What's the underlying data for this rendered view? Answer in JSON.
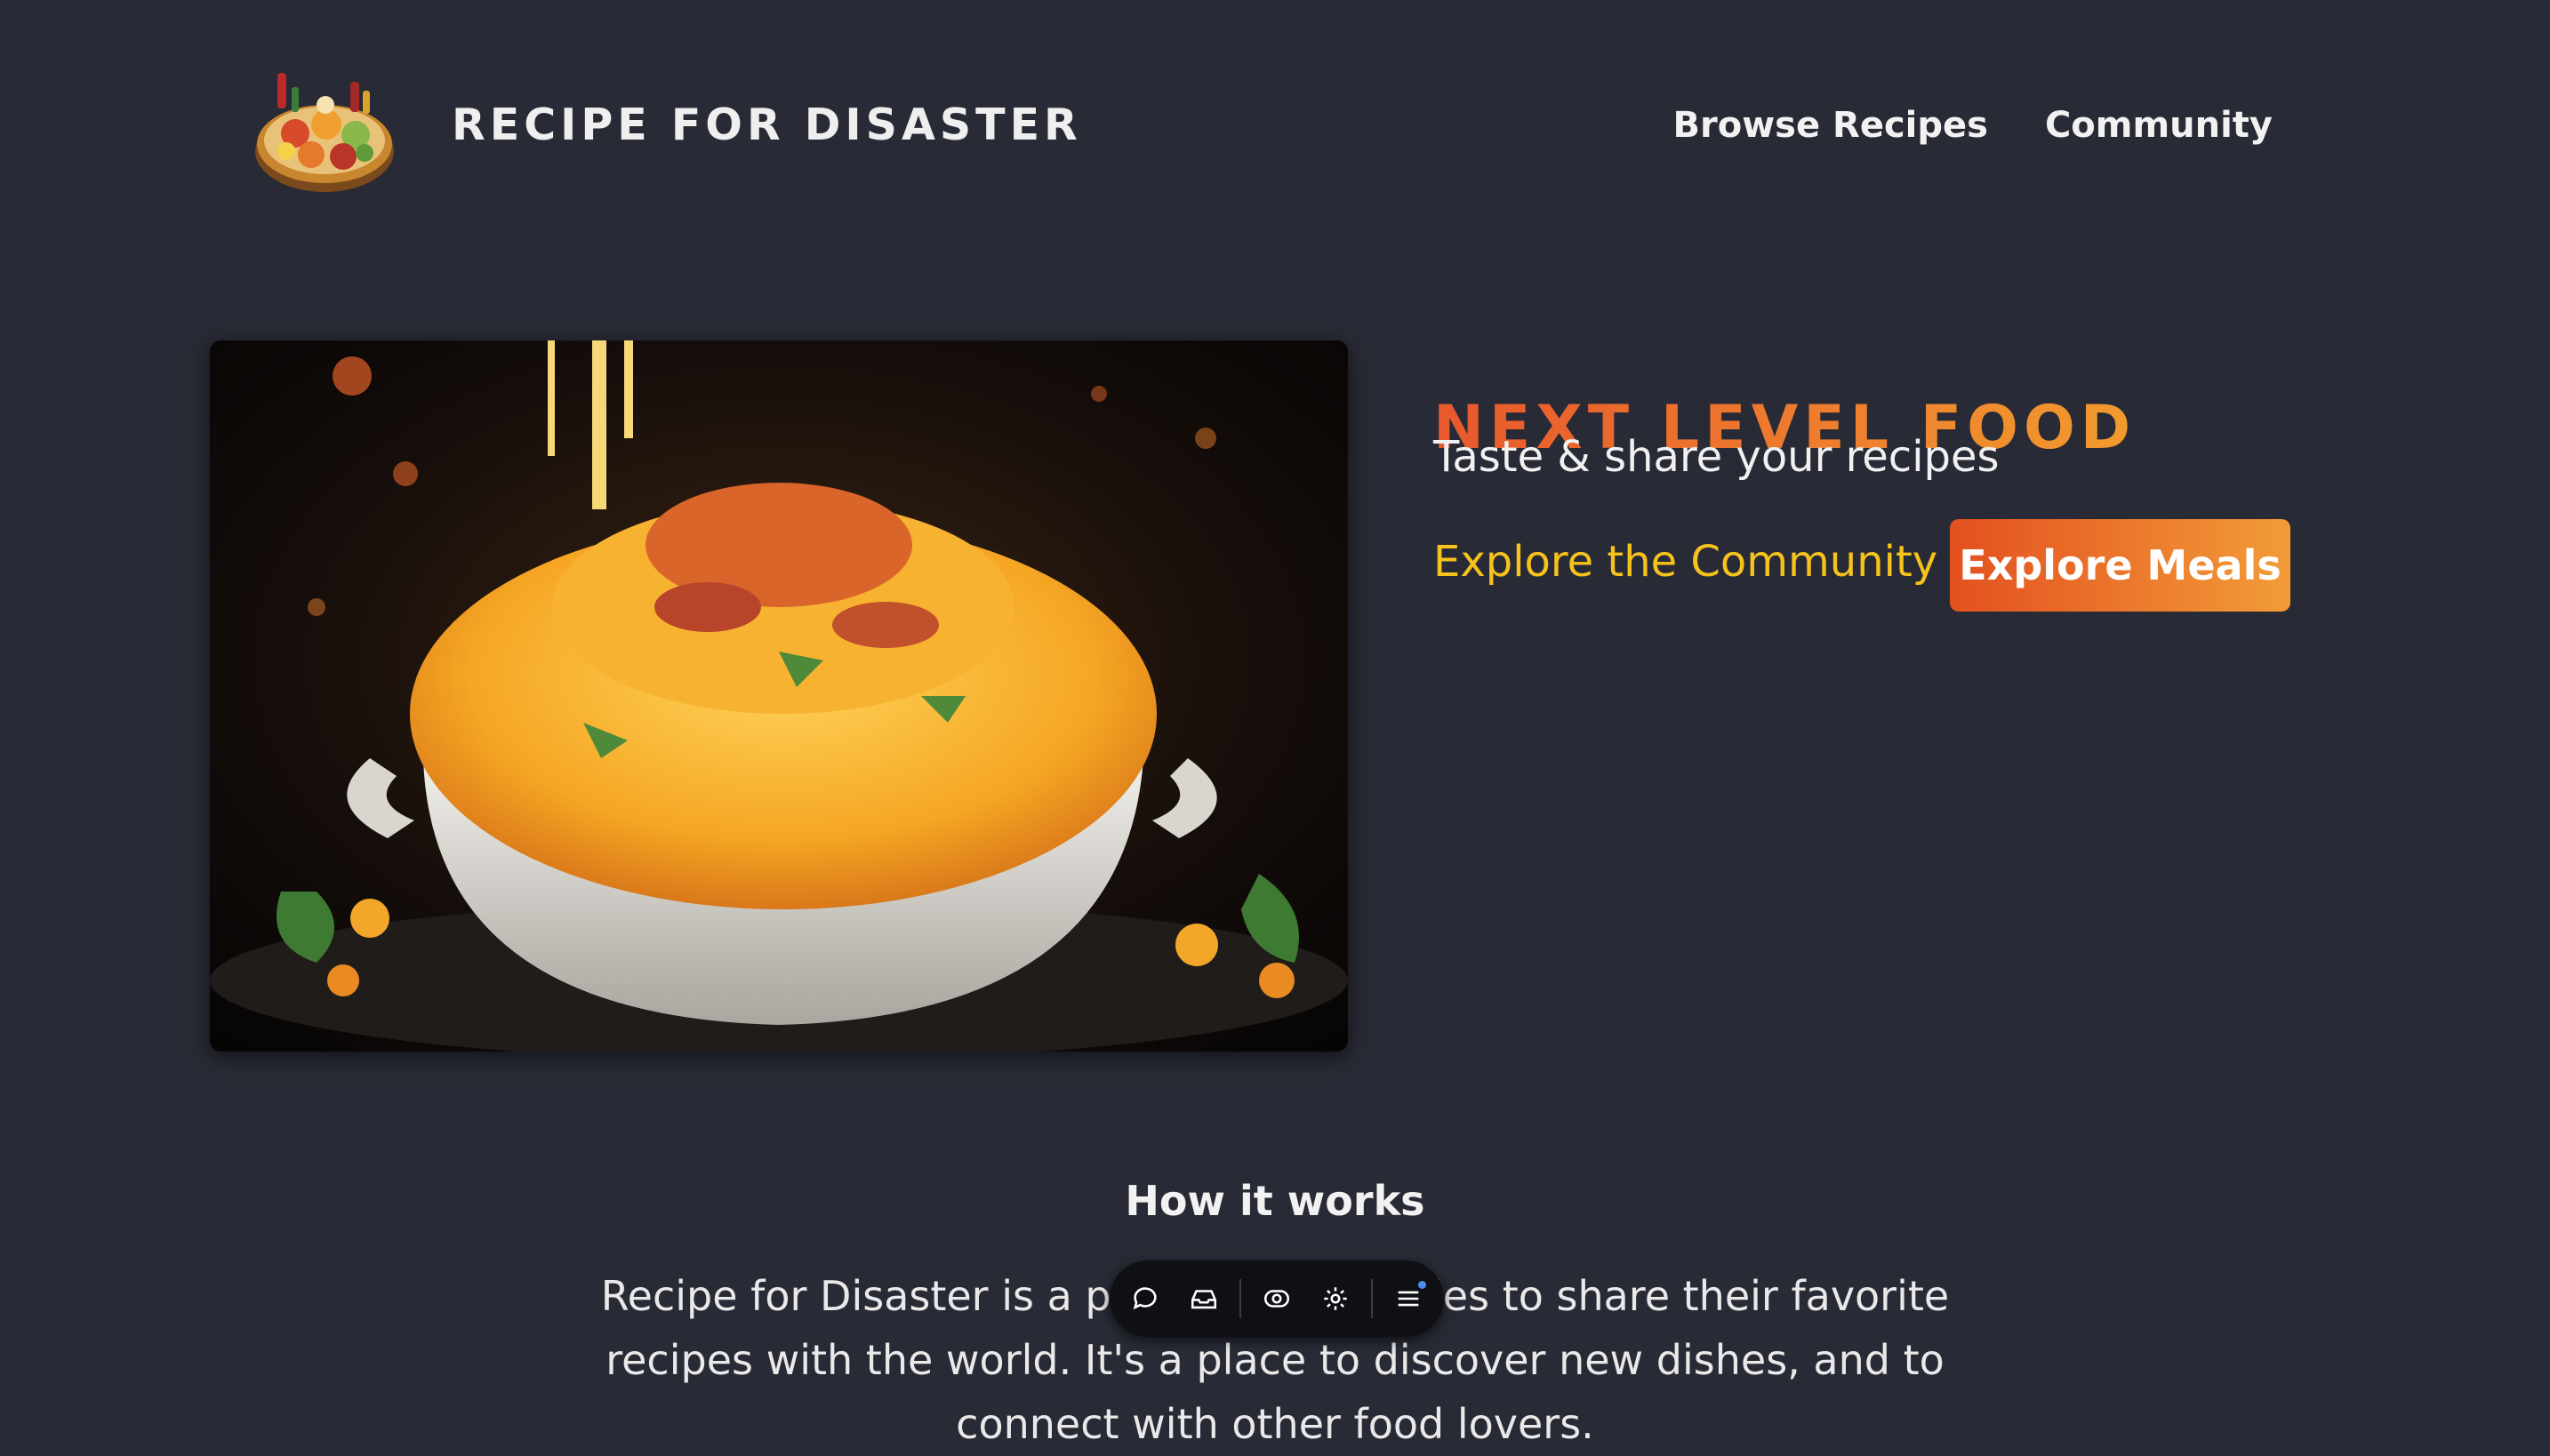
{
  "brand": {
    "name": "RECIPE FOR DISASTER",
    "logo_icon": "food-platter-logo-icon"
  },
  "nav": {
    "items": [
      {
        "label": "Browse Recipes"
      },
      {
        "label": "Community"
      }
    ]
  },
  "hero": {
    "image_icon": "mac-and-cheese-photo",
    "title": "NEXT LEVEL FOOD",
    "subtitle": "Taste & share your recipes",
    "link_label": "Explore the Community",
    "button_label": "Explore Meals",
    "accent_colors": [
      "#e8582d",
      "#f29b2e"
    ],
    "link_color": "#f6c21c"
  },
  "how": {
    "title": "How it works",
    "text": "Recipe for Disaster is a platform for foodies to share their favorite recipes with the world. It's a place to discover new dishes, and to connect with other food lovers."
  },
  "toolbar": {
    "icons": [
      "comment-icon",
      "inbox-icon",
      "eye-icon",
      "settings-icon",
      "menu-icon"
    ]
  },
  "colors": {
    "background": "#282a35",
    "text": "#f2f2f2"
  }
}
